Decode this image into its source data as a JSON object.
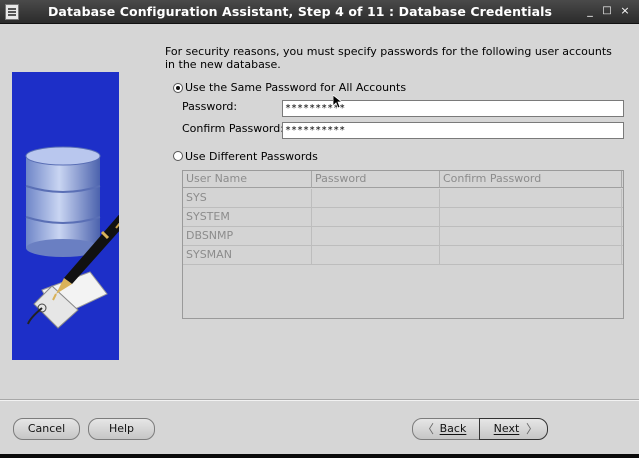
{
  "window": {
    "title": "Database Configuration Assistant, Step 4 of 11 : Database Credentials",
    "controls": {
      "minimize": "_",
      "maximize": "□",
      "close": "×"
    }
  },
  "instructions": "For security reasons, you must specify passwords for the following user accounts in the new database.",
  "same_password": {
    "label": "Use the Same Password for All Accounts",
    "selected": true,
    "password_label": "Password:",
    "password_value": "**********",
    "confirm_label": "Confirm Password:",
    "confirm_value": "**********"
  },
  "different_passwords": {
    "label": "Use Different Passwords",
    "selected": false,
    "columns": [
      "User Name",
      "Password",
      "Confirm Password"
    ],
    "rows": [
      {
        "user": "SYS"
      },
      {
        "user": "SYSTEM"
      },
      {
        "user": "DBSNMP"
      },
      {
        "user": "SYSMAN"
      }
    ]
  },
  "buttons": {
    "cancel": "Cancel",
    "help": "Help",
    "back": "Back",
    "next": "Next"
  },
  "colors": {
    "titlebar": "#333333",
    "dialog_bg": "#d6d6d6",
    "art_bg": "#1d2fc8"
  }
}
